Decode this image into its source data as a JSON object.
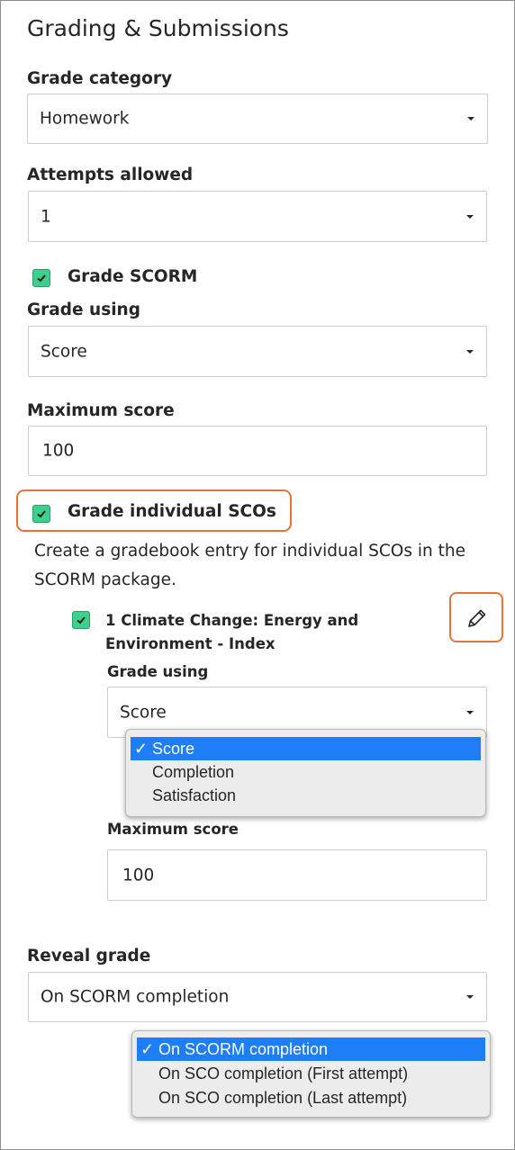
{
  "section": {
    "title": "Grading & Submissions"
  },
  "grade_category": {
    "label": "Grade category",
    "value": "Homework"
  },
  "attempts_allowed": {
    "label": "Attempts allowed",
    "value": "1"
  },
  "grade_scorm": {
    "label": "Grade SCORM",
    "checked": true
  },
  "grade_using": {
    "label": "Grade using",
    "value": "Score"
  },
  "maximum_score": {
    "label": "Maximum score",
    "value": "100"
  },
  "grade_individual_scos": {
    "label": "Grade individual SCOs",
    "checked": true,
    "description": "Create a gradebook entry for individual SCOs in the SCORM package."
  },
  "sco_item": {
    "title": "1 Climate Change: Energy and Environment - Index",
    "checked": true,
    "edit_icon": "pencil-icon",
    "grade_using": {
      "label": "Grade using",
      "value": "Score",
      "options": [
        {
          "check": "✓",
          "label": "Score"
        },
        {
          "check": "",
          "label": "Completion"
        },
        {
          "check": "",
          "label": "Satisfaction"
        }
      ]
    },
    "maximum_score": {
      "label": "Maximum score",
      "value": "100"
    }
  },
  "reveal_grade": {
    "label": "Reveal grade",
    "value": "On SCORM completion",
    "options": [
      {
        "check": "✓",
        "label": "On SCORM completion"
      },
      {
        "check": "",
        "label": "On SCO completion (First attempt)"
      },
      {
        "check": "",
        "label": "On SCO completion (Last attempt)"
      }
    ]
  },
  "colors": {
    "checkbox_green": "#3ccf8e",
    "highlight_orange": "#e0763c",
    "selected_option_blue": "#1f7ef7"
  }
}
